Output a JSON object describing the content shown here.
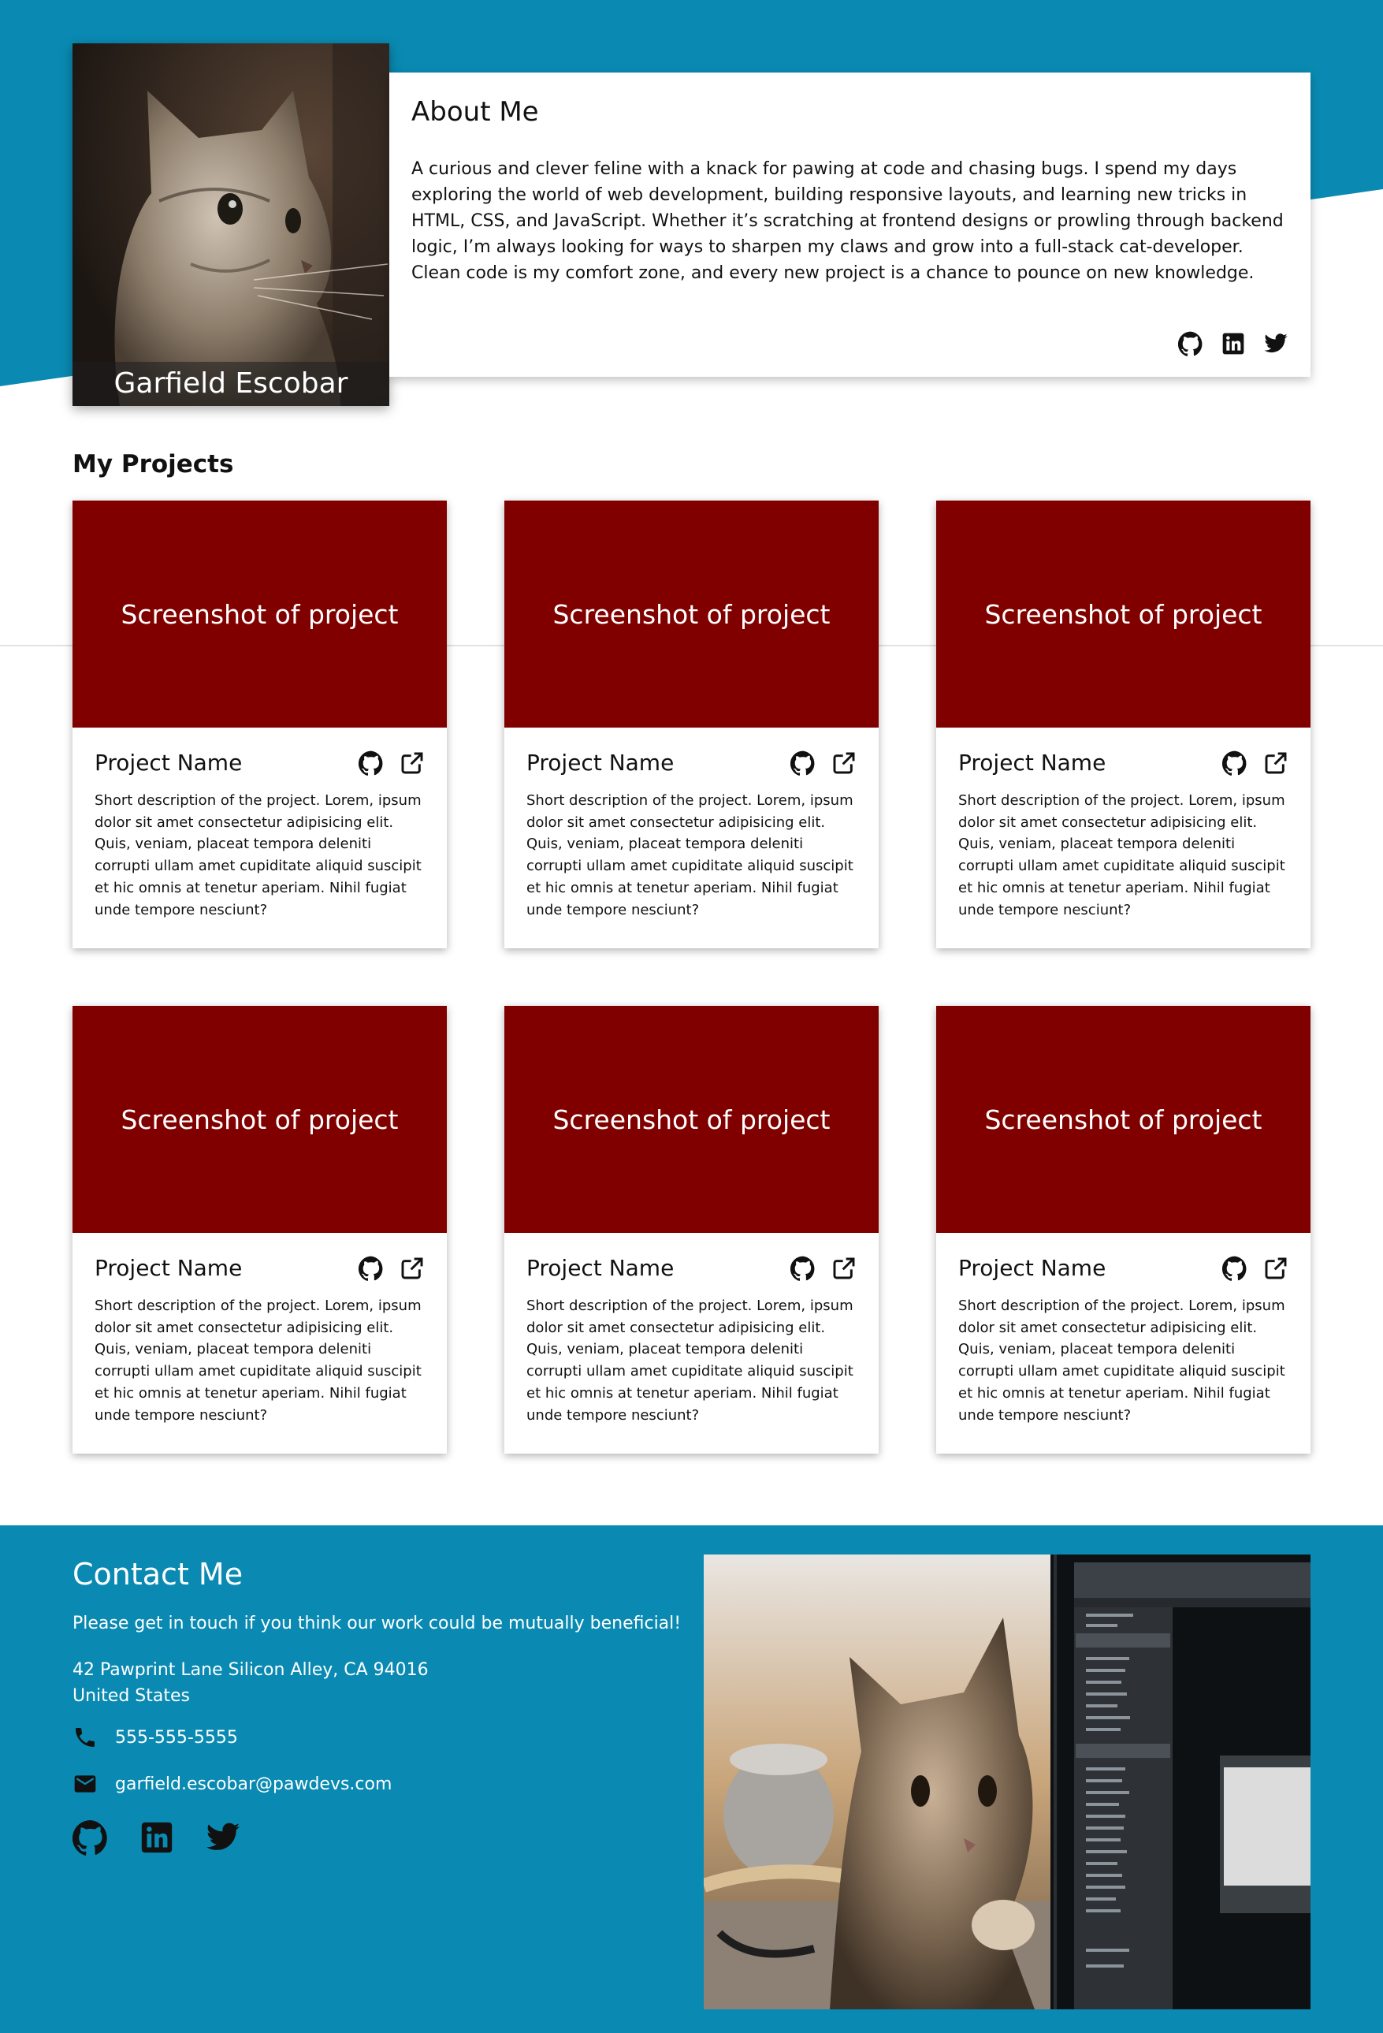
{
  "colors": {
    "accent": "#0a8ab2",
    "card_shot": "#800000",
    "background": "#ffffff"
  },
  "profile": {
    "name": "Garfield Escobar",
    "photo_alt": "cat-portrait"
  },
  "about": {
    "title": "About Me",
    "text": "A curious and clever feline with a knack for pawing at code and chasing bugs. I spend my days exploring the world of web development, building responsive layouts, and learning new tricks in HTML, CSS, and JavaScript. Whether it’s scratching at frontend designs or prowling through backend logic, I’m always looking for ways to sharpen my claws and grow into a full-stack cat-developer. Clean code is my comfort zone, and every new project is a chance to pounce on new knowledge.",
    "icons": [
      "github-icon",
      "linkedin-icon",
      "twitter-icon"
    ]
  },
  "projects": {
    "title": "My Projects",
    "items": [
      {
        "screenshot": "Screenshot of project",
        "name": "Project Name",
        "description": "Short description of the project. Lorem, ipsum dolor sit amet consectetur adipisicing elit. Quis, veniam, placeat tempora deleniti corrupti ullam amet cupiditate aliquid suscipit et hic omnis at tenetur aperiam. Nihil fugiat unde tempore nesciunt?"
      },
      {
        "screenshot": "Screenshot of project",
        "name": "Project Name",
        "description": "Short description of the project. Lorem, ipsum dolor sit amet consectetur adipisicing elit. Quis, veniam, placeat tempora deleniti corrupti ullam amet cupiditate aliquid suscipit et hic omnis at tenetur aperiam. Nihil fugiat unde tempore nesciunt?"
      },
      {
        "screenshot": "Screenshot of project",
        "name": "Project Name",
        "description": "Short description of the project. Lorem, ipsum dolor sit amet consectetur adipisicing elit. Quis, veniam, placeat tempora deleniti corrupti ullam amet cupiditate aliquid suscipit et hic omnis at tenetur aperiam. Nihil fugiat unde tempore nesciunt?"
      },
      {
        "screenshot": "Screenshot of project",
        "name": "Project Name",
        "description": "Short description of the project. Lorem, ipsum dolor sit amet consectetur adipisicing elit. Quis, veniam, placeat tempora deleniti corrupti ullam amet cupiditate aliquid suscipit et hic omnis at tenetur aperiam. Nihil fugiat unde tempore nesciunt?"
      },
      {
        "screenshot": "Screenshot of project",
        "name": "Project Name",
        "description": "Short description of the project. Lorem, ipsum dolor sit amet consectetur adipisicing elit. Quis, veniam, placeat tempora deleniti corrupti ullam amet cupiditate aliquid suscipit et hic omnis at tenetur aperiam. Nihil fugiat unde tempore nesciunt?"
      },
      {
        "screenshot": "Screenshot of project",
        "name": "Project Name",
        "description": "Short description of the project. Lorem, ipsum dolor sit amet consectetur adipisicing elit. Quis, veniam, placeat tempora deleniti corrupti ullam amet cupiditate aliquid suscipit et hic omnis at tenetur aperiam. Nihil fugiat unde tempore nesciunt?"
      }
    ]
  },
  "contact": {
    "title": "Contact Me",
    "intro": "Please get in touch if you think our work could be mutually beneficial!",
    "address_line1": "42 Pawprint Lane Silicon Alley, CA 94016",
    "address_line2": "United States",
    "phone": "555-555-5555",
    "email": "garfield.escobar@pawdevs.com",
    "icons": [
      "phone-icon",
      "email-icon",
      "github-icon",
      "linkedin-icon",
      "twitter-icon"
    ]
  }
}
